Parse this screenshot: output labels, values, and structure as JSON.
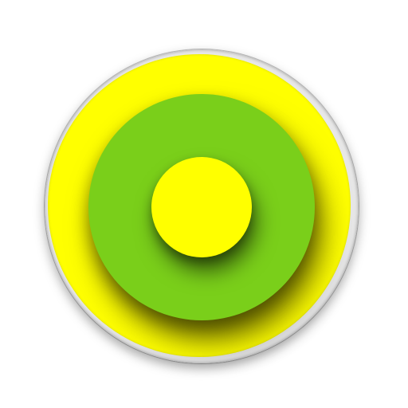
{
  "colors": {
    "outer_ring": "#ffff00",
    "middle_disc": "#7acf1a",
    "center_dot": "#ffff00",
    "bezel": "#e6e6e6"
  }
}
